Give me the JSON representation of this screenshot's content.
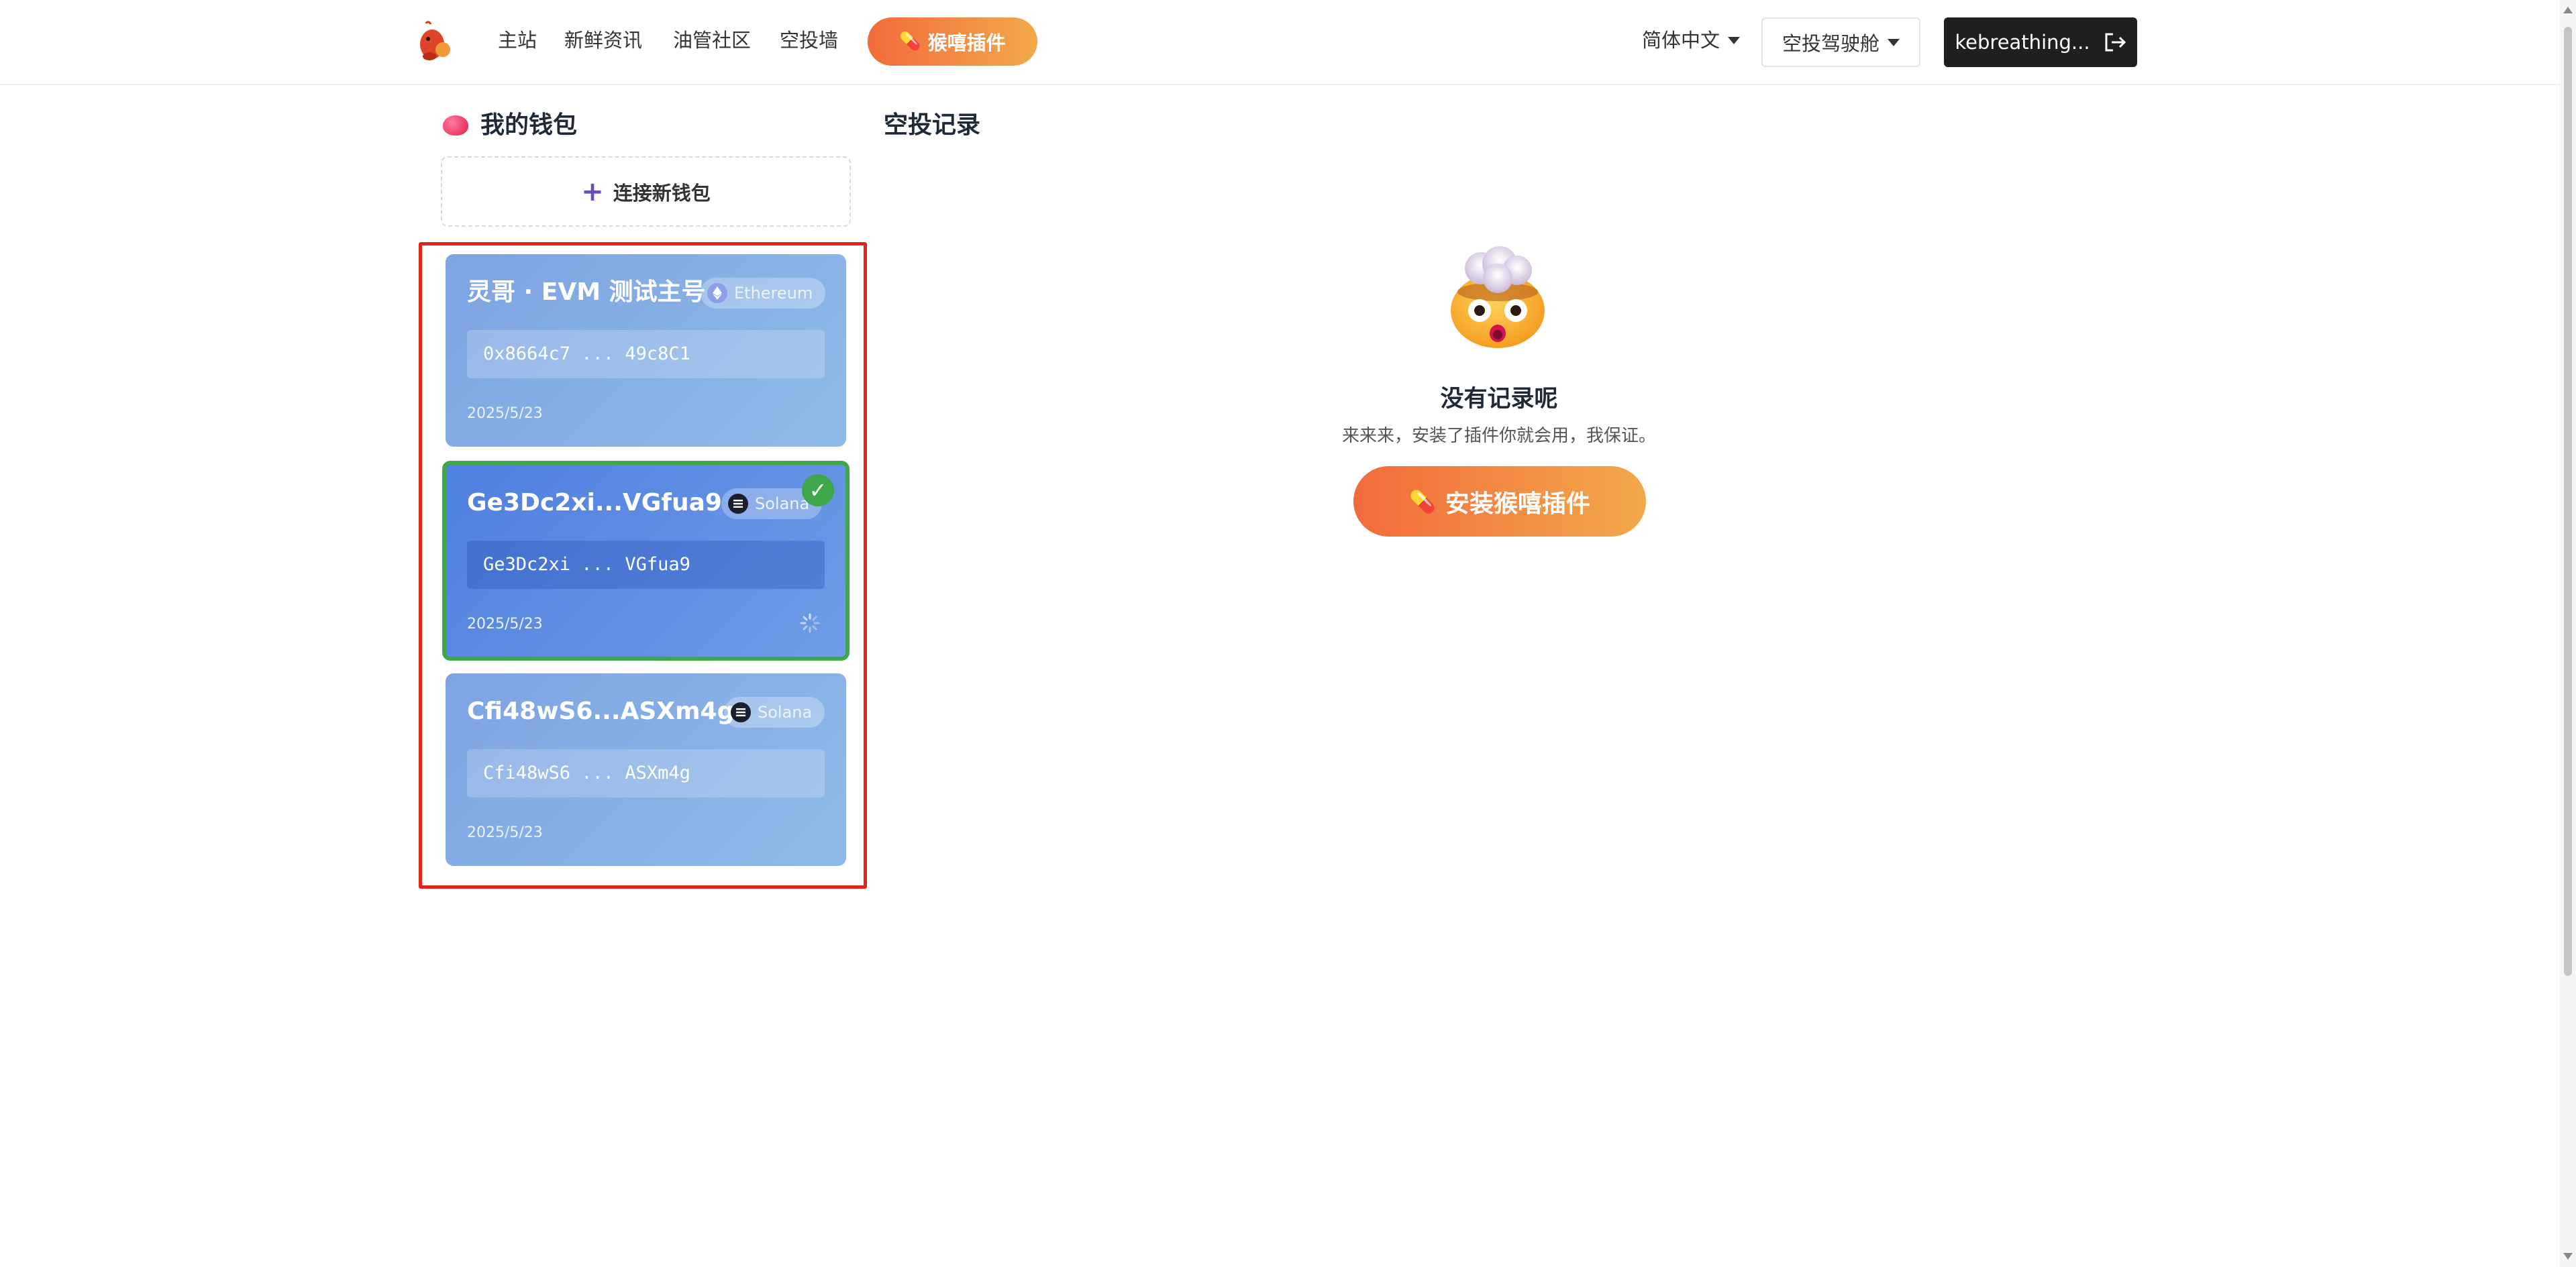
{
  "nav": {
    "links": [
      "主站",
      "新鲜资讯",
      "油管社区",
      "空投墙"
    ],
    "plugin_label": "猴嘻插件",
    "language": "简体中文",
    "cockpit": "空投驾驶舱",
    "user": "kebreathing..."
  },
  "wallet": {
    "title": "我的钱包",
    "connect_label": "连接新钱包",
    "cards": [
      {
        "name": "灵哥 · EVM 测试主号",
        "chain": "Ethereum",
        "address": "0x8664c7 ... 49c8C1",
        "date": "2025/5/23",
        "active": false
      },
      {
        "name": "Ge3Dc2xi...VGfua9",
        "chain": "Solana",
        "address": "Ge3Dc2xi ... VGfua9",
        "date": "2025/5/23",
        "active": true
      },
      {
        "name": "Cfi48wS6...ASXm4g",
        "chain": "Solana",
        "address": "Cfi48wS6 ... ASXm4g",
        "date": "2025/5/23",
        "active": false
      }
    ]
  },
  "airdrop": {
    "title": "空投记录",
    "empty_title": "没有记录呢",
    "empty_sub": "来来来，安装了插件你就会用，我保证。",
    "install_label": "安装猴嘻插件"
  },
  "colors": {
    "accent_start": "#f26b3b",
    "accent_end": "#f2a94a",
    "card_blue": "#7da3e3",
    "active_border": "#3ea74a",
    "highlight_red": "#e3241b"
  }
}
